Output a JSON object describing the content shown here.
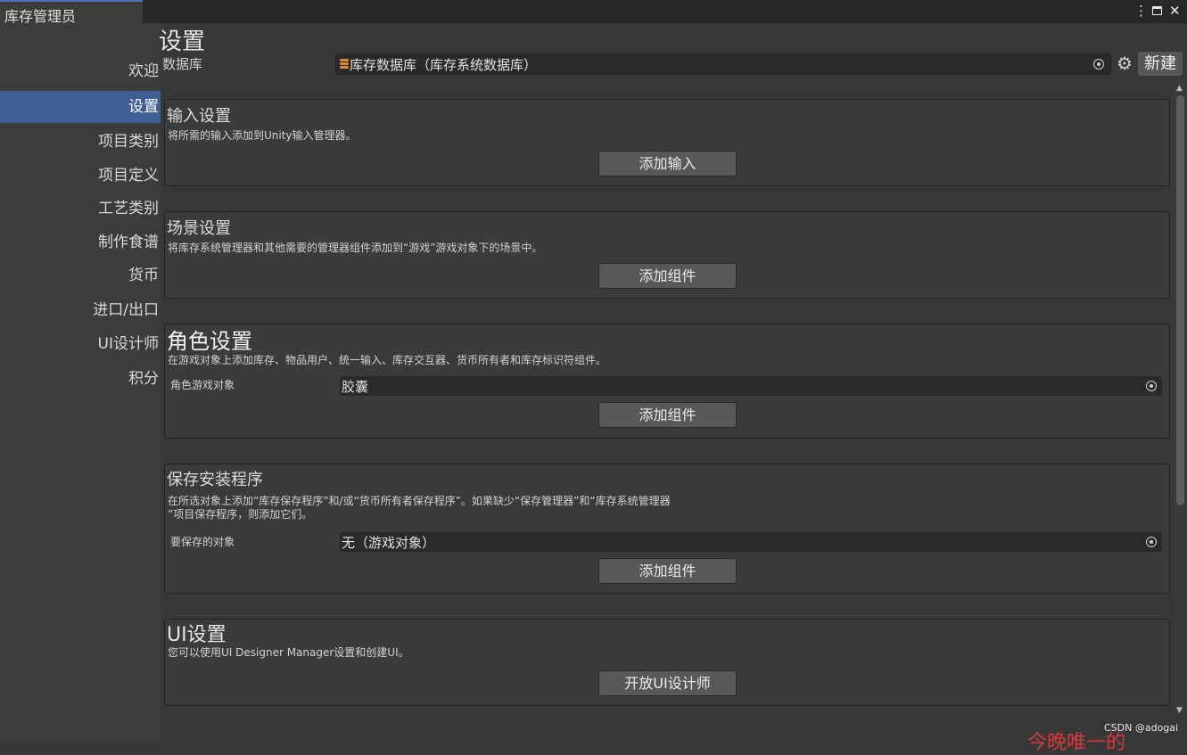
{
  "window": {
    "tab_title": "库存管理员",
    "menu_glyph": "⋮",
    "close_glyph": "✕"
  },
  "sidebar": {
    "items": [
      {
        "label": "欢迎",
        "active": false
      },
      {
        "label": "设置",
        "active": true
      },
      {
        "label": "项目类别",
        "active": false
      },
      {
        "label": "项目定义",
        "active": false
      },
      {
        "label": "工艺类别",
        "active": false
      },
      {
        "label": "制作食谱",
        "active": false
      },
      {
        "label": "货币",
        "active": false
      },
      {
        "label": "进口/出口",
        "active": false
      },
      {
        "label": "UI设计师",
        "active": false
      },
      {
        "label": "积分",
        "active": false
      }
    ]
  },
  "header": {
    "title": "设置",
    "database_label": "数据库",
    "database_value": "库存数据库（库存系统数据库）",
    "new_button": "新建",
    "gear_glyph": "⚙"
  },
  "sections": {
    "input": {
      "title": "输入设置",
      "desc": "将所需的输入添加到Unity输入管理器。",
      "button": "添加输入"
    },
    "scene": {
      "title": "场景设置",
      "desc": "将库存系统管理器和其他需要的管理器组件添加到“游戏”游戏对象下的场景中。",
      "button": "添加组件"
    },
    "character": {
      "title": "角色设置",
      "desc": "在游戏对象上添加库存、物品用户、统一输入、库存交互器、货币所有者和库存标识符组件。",
      "field_label": "角色游戏对象",
      "field_value": "胶囊",
      "button": "添加组件"
    },
    "save": {
      "title": "保存安装程序",
      "desc": "在所选对象上添加“库存保存程序”和/或“货币所有者保存程序”。如果缺少“保存管理器”和“库存系统管理器\n”项目保存程序，则添加它们。",
      "field_label": "要保存的对象",
      "field_value": "无（游戏对象）",
      "button": "添加组件"
    },
    "ui": {
      "title": "UI设置",
      "desc": "您可以使用UI Designer Manager设置和创建UI。",
      "button": "开放UI设计师"
    }
  },
  "footer": {
    "credit": "CSDN @adogai",
    "watermark": "今晚唯一的"
  },
  "colors": {
    "accent": "#3e5f96",
    "tab_accent": "#4a6fb5",
    "database_icon": "#e38a2c"
  }
}
